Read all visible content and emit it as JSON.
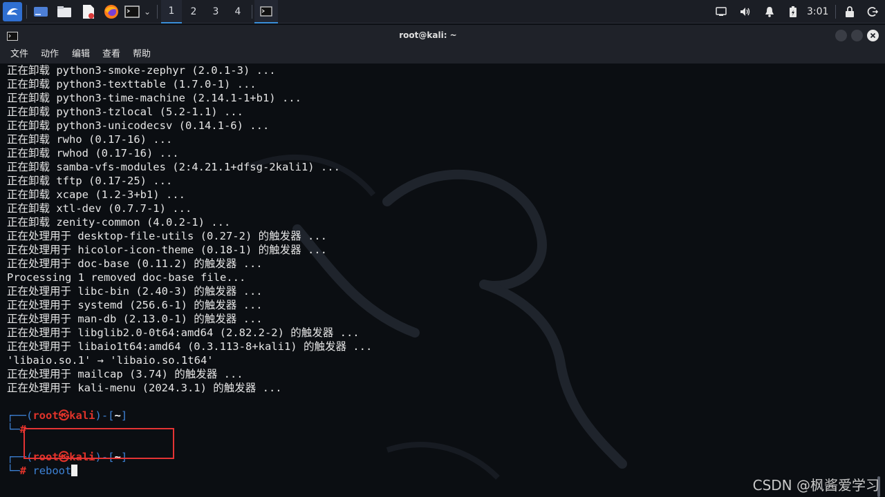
{
  "taskbar": {
    "workspaces": [
      "1",
      "2",
      "3",
      "4"
    ],
    "active_workspace": "1",
    "clock": "3:01",
    "icons": [
      "kali-menu-icon",
      "desktop-icon",
      "file-manager-icon",
      "text-editor-icon",
      "firefox-icon",
      "terminal-icon",
      "terminal-task-icon",
      "display-icon",
      "volume-icon",
      "notification-icon",
      "battery-icon",
      "lock-icon",
      "logout-icon"
    ]
  },
  "window": {
    "title": "root@kali: ~",
    "menu": [
      "文件",
      "动作",
      "编辑",
      "查看",
      "帮助"
    ]
  },
  "terminal": {
    "lines": [
      "正在卸载 python3-smoke-zephyr (2.0.1-3) ...",
      "正在卸载 python3-texttable (1.7.0-1) ...",
      "正在卸载 python3-time-machine (2.14.1-1+b1) ...",
      "正在卸载 python3-tzlocal (5.2-1.1) ...",
      "正在卸载 python3-unicodecsv (0.14.1-6) ...",
      "正在卸载 rwho (0.17-16) ...",
      "正在卸载 rwhod (0.17-16) ...",
      "正在卸载 samba-vfs-modules (2:4.21.1+dfsg-2kali1) ...",
      "正在卸载 tftp (0.17-25) ...",
      "正在卸载 xcape (1.2-3+b1) ...",
      "正在卸载 xtl-dev (0.7.7-1) ...",
      "正在卸载 zenity-common (4.0.2-1) ...",
      "正在处理用于 desktop-file-utils (0.27-2) 的触发器 ...",
      "正在处理用于 hicolor-icon-theme (0.18-1) 的触发器 ...",
      "正在处理用于 doc-base (0.11.2) 的触发器 ...",
      "Processing 1 removed doc-base file...",
      "正在处理用于 libc-bin (2.40-3) 的触发器 ...",
      "正在处理用于 systemd (256.6-1) 的触发器 ...",
      "正在处理用于 man-db (2.13.0-1) 的触发器 ...",
      "正在处理用于 libglib2.0-0t64:amd64 (2.82.2-2) 的触发器 ...",
      "正在处理用于 libaio1t64:amd64 (0.3.113-8+kali1) 的触发器 ...",
      "'libaio.so.1' → 'libaio.so.1t64'",
      "正在处理用于 mailcap (3.74) 的触发器 ...",
      "正在处理用于 kali-menu (2024.3.1) 的触发器 ..."
    ],
    "prompt": {
      "open": "┌──(",
      "user_host": "root㉿kali",
      "mid": ")-[",
      "dir": "~",
      "close": "]",
      "corner": "└─",
      "symbol": "#"
    },
    "command": "reboot"
  },
  "watermark": "CSDN @枫酱爱学习",
  "colors": {
    "prompt_red": "#e0332a",
    "prompt_blue": "#3d82d6",
    "highlight_box": "#e53434",
    "active_workspace": "#3a8fd9"
  }
}
